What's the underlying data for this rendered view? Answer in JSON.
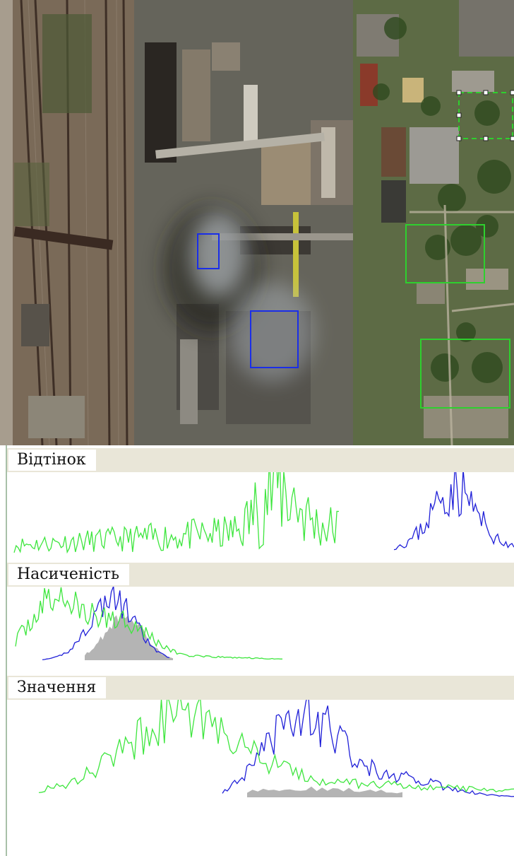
{
  "colors": {
    "roi_blue": "#1a2ee8",
    "roi_green": "#2ed02e",
    "hist_green": "#3ee63e",
    "hist_blue": "#2020d8",
    "hist_overlap": "#b4b4b4",
    "header_bg": "#e9e6d8"
  },
  "histograms": [
    {
      "id": "hue",
      "label": "Відтінок"
    },
    {
      "id": "saturation",
      "label": "Насиченість"
    },
    {
      "id": "value",
      "label": "Значення"
    }
  ]
}
